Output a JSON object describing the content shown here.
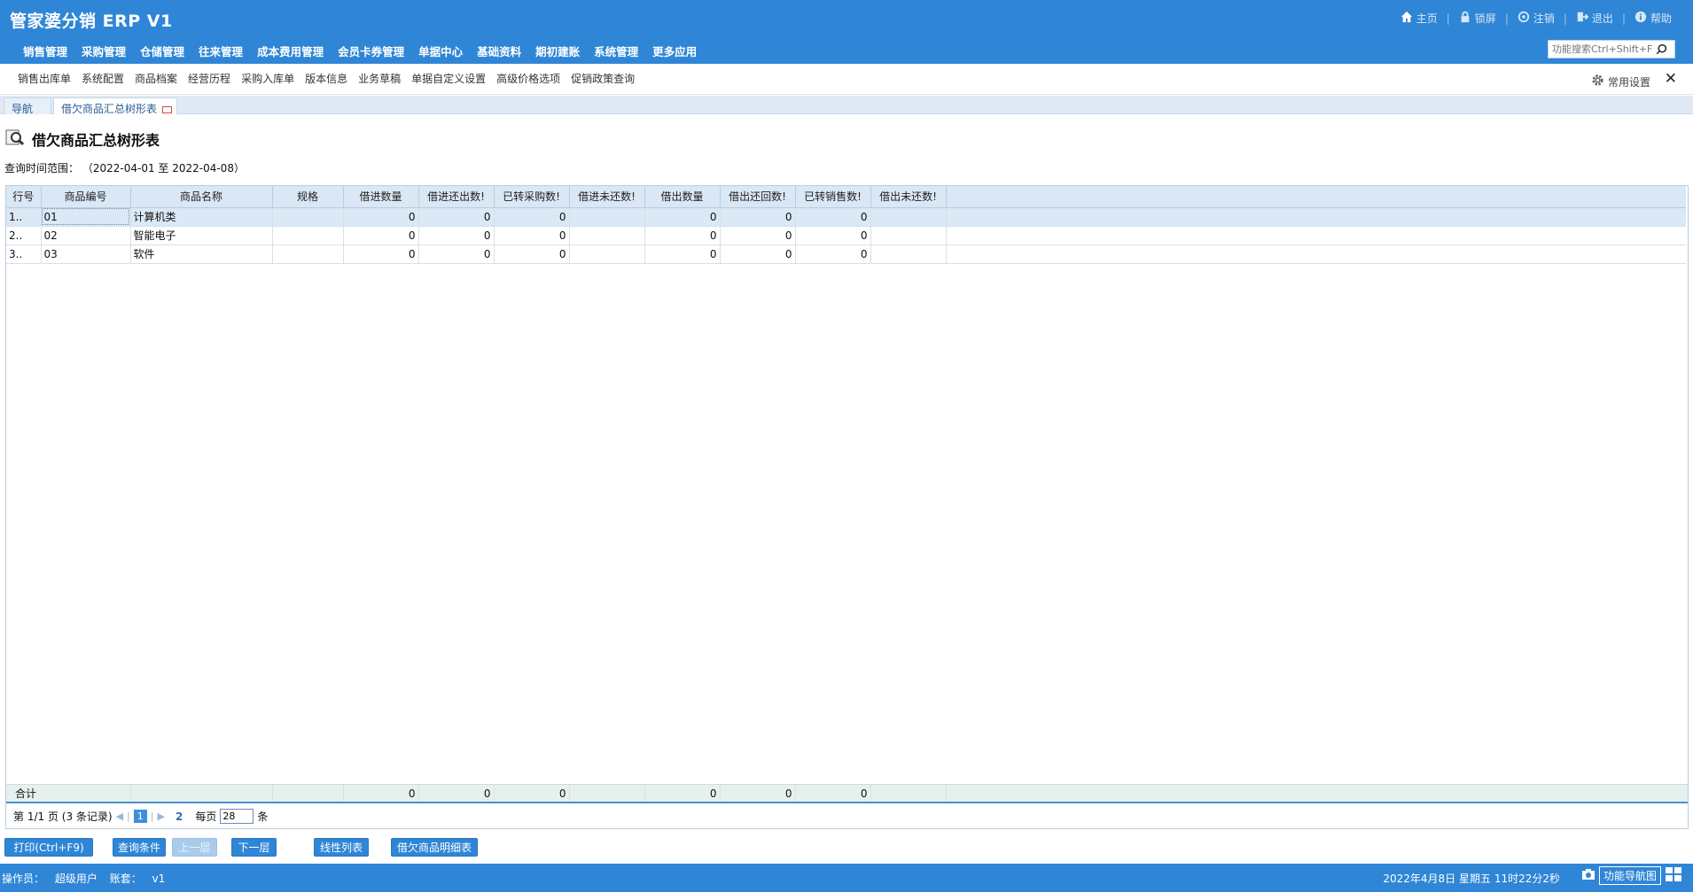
{
  "app": {
    "title": "管家婆分销 ERP V1"
  },
  "top_links": [
    {
      "label": "主页",
      "icon": "home-icon"
    },
    {
      "label": "锁屏",
      "icon": "lock-icon"
    },
    {
      "label": "注销",
      "icon": "logout-circle-icon"
    },
    {
      "label": "退出",
      "icon": "exit-icon"
    },
    {
      "label": "帮助",
      "icon": "info-icon"
    }
  ],
  "main_nav": [
    "销售管理",
    "采购管理",
    "仓储管理",
    "往来管理",
    "成本费用管理",
    "会员卡券管理",
    "单据中心",
    "基础资料",
    "期初建账",
    "系统管理",
    "更多应用"
  ],
  "search": {
    "placeholder": "功能搜索Ctrl+Shift+F"
  },
  "quick_links": [
    "销售出库单",
    "系统配置",
    "商品档案",
    "经营历程",
    "采购入库单",
    "版本信息",
    "业务草稿",
    "单据自定义设置",
    "高级价格选项",
    "促销政策查询"
  ],
  "settings": {
    "label": "常用设置"
  },
  "tabs": {
    "nav": "导航",
    "report": "借欠商品汇总树形表"
  },
  "page": {
    "title": "借欠商品汇总树形表",
    "query_range_label": "查询时间范围：",
    "query_range_value": "（2022-04-01 至  2022-04-08）"
  },
  "table": {
    "columns": [
      "行号",
      "商品编号",
      "商品名称",
      "规格",
      "借进数量",
      "借进还出数!",
      "已转采购数!",
      "借进未还数!",
      "借出数量",
      "借出还回数!",
      "已转销售数!",
      "借出未还数!"
    ],
    "rows": [
      [
        "1..",
        "01",
        "计算机类",
        "",
        "0",
        "0",
        "0",
        "",
        "0",
        "0",
        "0",
        ""
      ],
      [
        "2..",
        "02",
        "智能电子",
        "",
        "0",
        "0",
        "0",
        "",
        "0",
        "0",
        "0",
        ""
      ],
      [
        "3..",
        "03",
        "软件",
        "",
        "0",
        "0",
        "0",
        "",
        "0",
        "0",
        "0",
        ""
      ]
    ],
    "totals": [
      "合计",
      "",
      "",
      "",
      "0",
      "0",
      "0",
      "",
      "0",
      "0",
      "0",
      ""
    ]
  },
  "pager": {
    "page_info": "第  1/1 页  (3 条记录)",
    "current_page": "1",
    "next_page": "2",
    "per_page_label": "每页",
    "per_page_value": "28",
    "unit": "条"
  },
  "actions": {
    "print": "打印(Ctrl+F9)",
    "query": "查询条件",
    "up": "上一层",
    "down": "下一层",
    "linear": "线性列表",
    "detail": "借欠商品明细表"
  },
  "status": {
    "operator_label": "操作员：",
    "operator": "超级用户",
    "account_label": "账套：",
    "account": "v1",
    "datetime": "2022年4月8日  星期五  11时22分2秒",
    "nav_map": "功能导航图"
  },
  "colors": {
    "brand_blue": "#2f86d6",
    "header_row": "#dae7f4",
    "selected_row": "#dbe8f5"
  }
}
